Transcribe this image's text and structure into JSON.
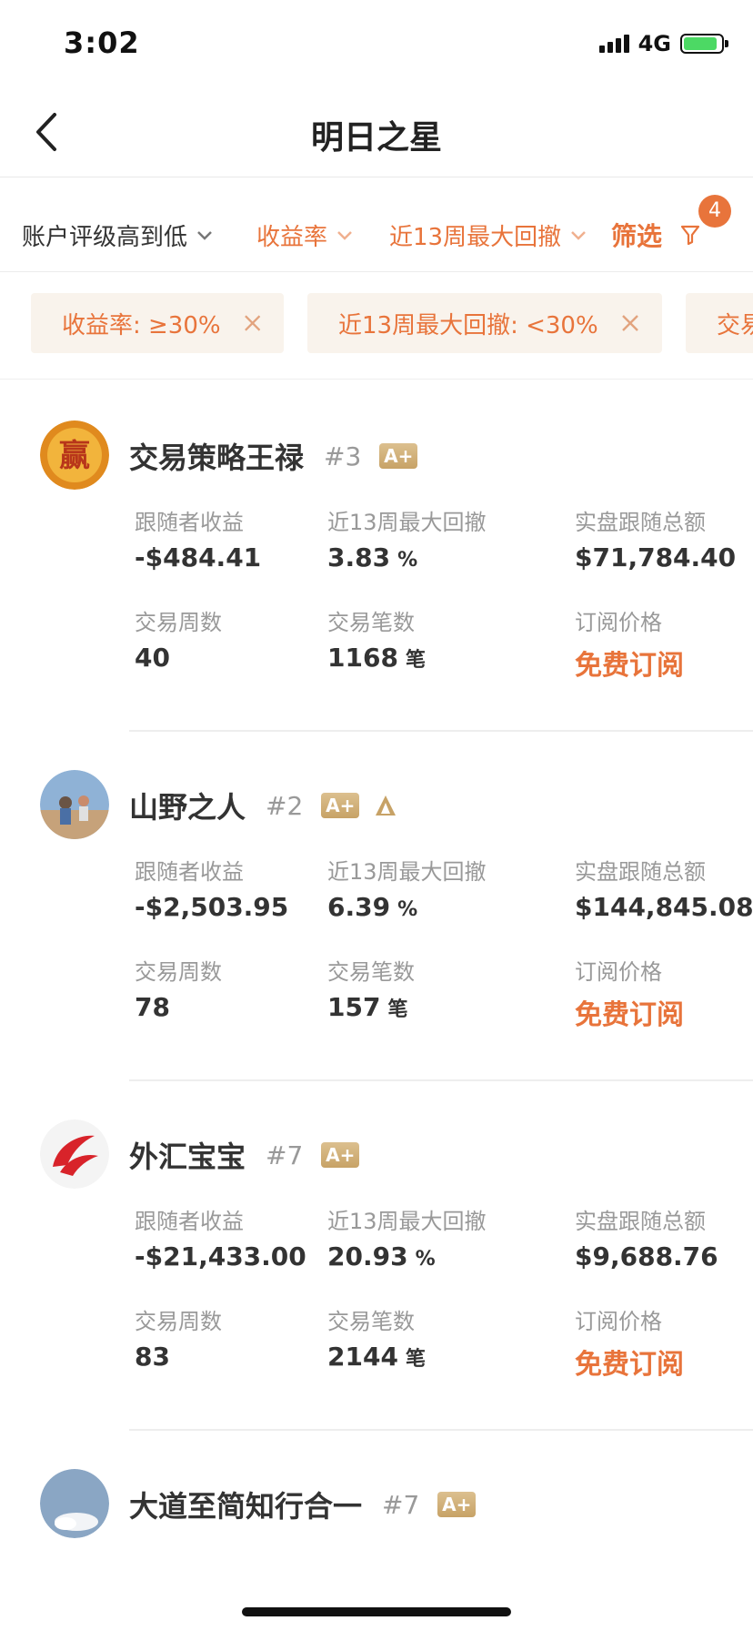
{
  "status": {
    "time": "3:02",
    "network": "4G"
  },
  "nav": {
    "title": "明日之星"
  },
  "sort": {
    "rating": "账户评级高到低",
    "return": "收益率",
    "drawdown": "近13周最大回撤",
    "filter": "筛选",
    "filter_count": "4"
  },
  "chips": [
    {
      "label": "收益率: ≥30%"
    },
    {
      "label": "近13周最大回撤: <30%"
    },
    {
      "label": "交易"
    }
  ],
  "labels": {
    "follower_profit": "跟随者收益",
    "max_drawdown": "近13周最大回撤",
    "live_follow_total": "实盘跟随总额",
    "trade_weeks": "交易周数",
    "trade_count": "交易笔数",
    "sub_price": "订阅价格",
    "percent_unit": "%",
    "count_unit": "笔"
  },
  "traders": [
    {
      "name": "交易策略王禄",
      "rank": "#3",
      "grade": "A+",
      "follower_profit": "-$484.41",
      "max_drawdown": "3.83",
      "live_follow_total": "$71,784.40",
      "trade_weeks": "40",
      "trade_count": "1168",
      "price": "免费订阅"
    },
    {
      "name": "山野之人",
      "rank": "#2",
      "grade": "A+",
      "follower_profit": "-$2,503.95",
      "max_drawdown": "6.39",
      "live_follow_total": "$144,845.08",
      "trade_weeks": "78",
      "trade_count": "157",
      "price": "免费订阅"
    },
    {
      "name": "外汇宝宝",
      "rank": "#7",
      "grade": "A+",
      "follower_profit": "-$21,433.00",
      "max_drawdown": "20.93",
      "live_follow_total": "$9,688.76",
      "trade_weeks": "83",
      "trade_count": "2144",
      "price": "免费订阅"
    },
    {
      "name": "大道至简知行合一",
      "rank": "#7",
      "grade": "A+"
    }
  ],
  "colors": {
    "accent": "#e8743b",
    "grade_gold": "#c7a266"
  }
}
